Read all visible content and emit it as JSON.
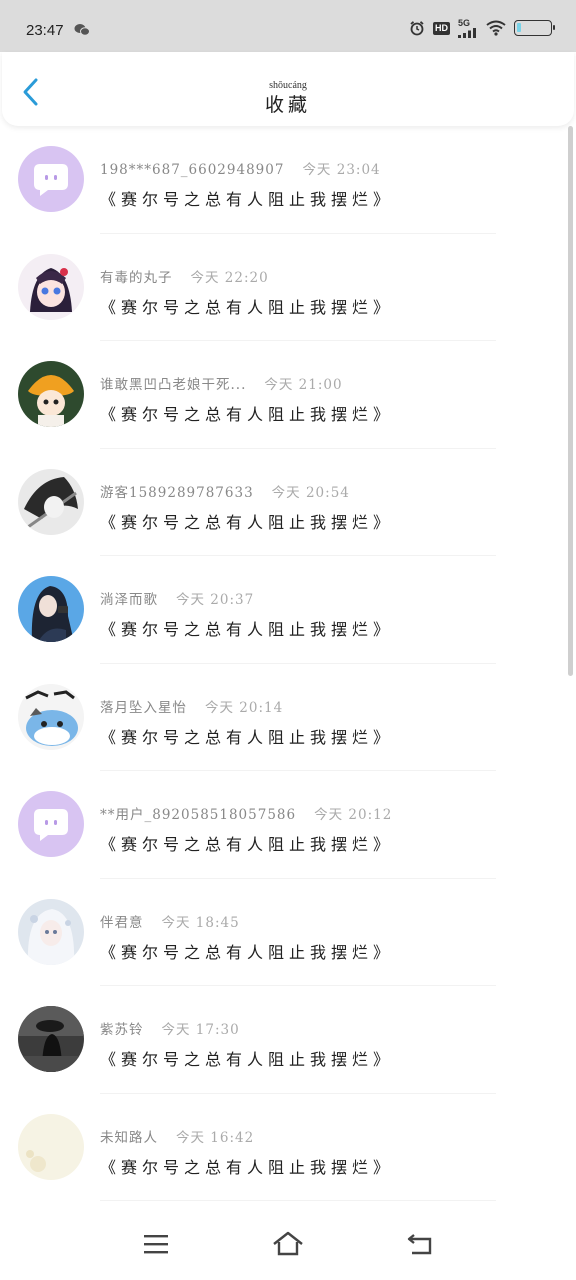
{
  "status_bar": {
    "time": "23:47",
    "hd_label": "HD",
    "network_label": "5G",
    "icons": [
      "wechat-icon",
      "alarm-icon",
      "hd-icon",
      "signal-icon",
      "wifi-icon",
      "battery-icon"
    ]
  },
  "header": {
    "title": "收藏",
    "title_pinyin": "shōucáng",
    "back_icon": "chevron-left-icon",
    "accent_color": "#2a9bd8"
  },
  "favorites": [
    {
      "author": "198***687_6602948907",
      "time": "今天 23:04",
      "title": "《赛尔号之总有人阻止我摆烂》"
    },
    {
      "author": "有毒的丸子",
      "time": "今天 22:20",
      "title": "《赛尔号之总有人阻止我摆烂》"
    },
    {
      "author": "谁敢黑凹凸老娘干死...",
      "time": "今天 21:00",
      "title": "《赛尔号之总有人阻止我摆烂》"
    },
    {
      "author": "游客1589289787633",
      "time": "今天 20:54",
      "title": "《赛尔号之总有人阻止我摆烂》"
    },
    {
      "author": "淌泽而歌",
      "time": "今天 20:37",
      "title": "《赛尔号之总有人阻止我摆烂》"
    },
    {
      "author": "落月坠入星怡",
      "time": "今天 20:14",
      "title": "《赛尔号之总有人阻止我摆烂》"
    },
    {
      "author": "**用户_892058518057586",
      "time": "今天 20:12",
      "title": "《赛尔号之总有人阻止我摆烂》"
    },
    {
      "author": "伴君意",
      "time": "今天 18:45",
      "title": "《赛尔号之总有人阻止我摆烂》"
    },
    {
      "author": "紫苏铃",
      "time": "今天 17:30",
      "title": "《赛尔号之总有人阻止我摆烂》"
    },
    {
      "author": "未知路人",
      "time": "今天 16:42",
      "title": "《赛尔号之总有人阻止我摆烂》"
    }
  ],
  "nav_bar": {
    "icons": [
      "menu-icon",
      "home-icon",
      "back-icon"
    ]
  }
}
